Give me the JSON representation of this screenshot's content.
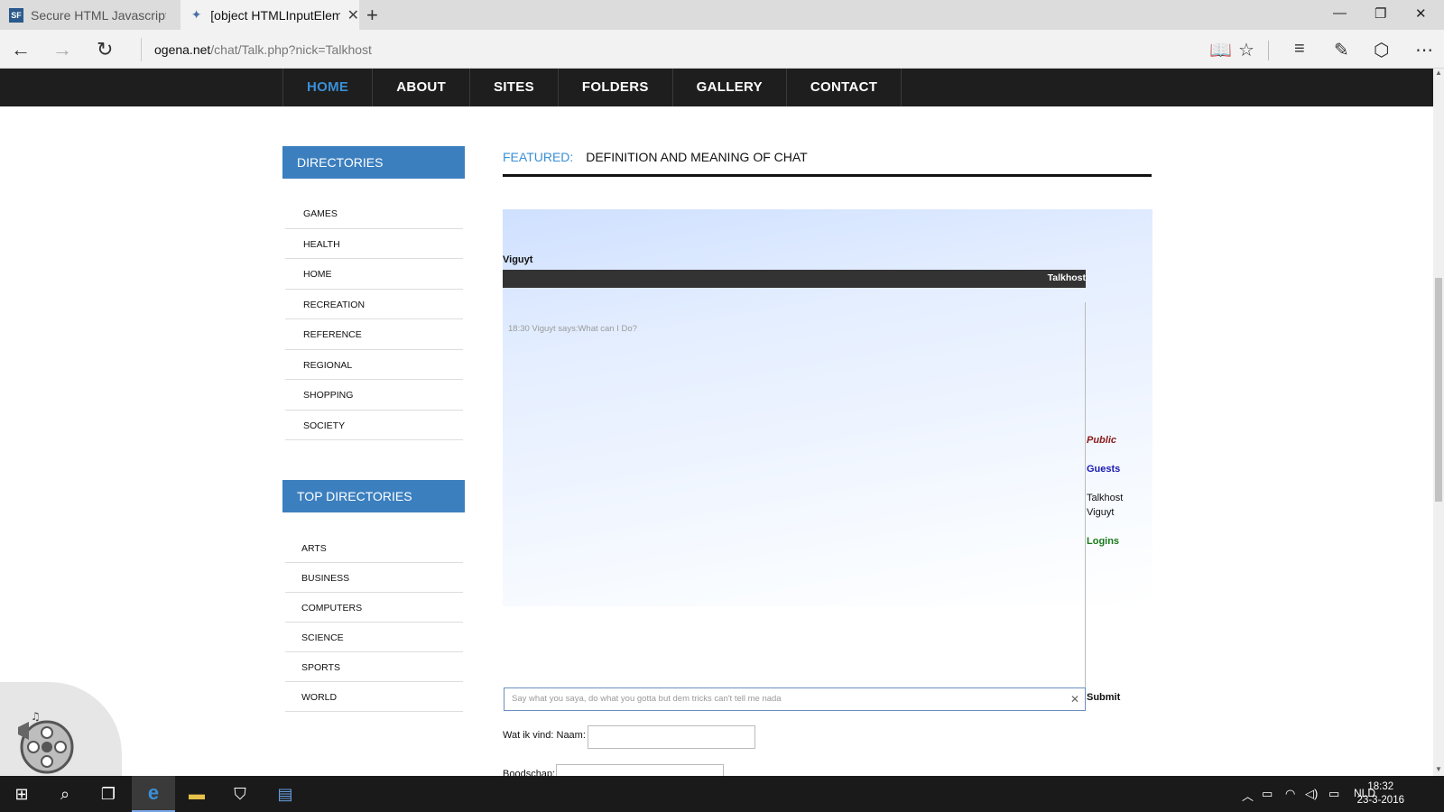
{
  "browser": {
    "tabs": [
      {
        "label": "Secure HTML Javascript Cha",
        "favicon": "SF",
        "active": false
      },
      {
        "label": "[object HTMLInputElem",
        "active": true
      }
    ],
    "url_host": "ogena.net",
    "url_path": "/chat/Talk.php?nick=Talkhost"
  },
  "site": {
    "nav": [
      "HOME",
      "ABOUT",
      "SITES",
      "FOLDERS",
      "GALLERY",
      "CONTACT"
    ],
    "directories_title": "DIRECTORIES",
    "directories": [
      "GAMES",
      "HEALTH",
      "HOME",
      "RECREATION",
      "REFERENCE",
      "REGIONAL",
      "SHOPPING",
      "SOCIETY"
    ],
    "top_directories_title": "TOP DIRECTORIES",
    "top_directories": [
      "ARTS",
      "BUSINESS",
      "COMPUTERS",
      "SCIENCE",
      "SPORTS",
      "WORLD"
    ],
    "featured_label": "FEATURED:",
    "featured_title": "DEFINITION AND MEANING OF CHAT"
  },
  "chat": {
    "current_user": "Viguyt",
    "header_user": "Talkhost",
    "message": "18:30 Viguyt says:What can I Do?",
    "public_label": "Public",
    "guests_label": "Guests",
    "users": [
      "Talkhost",
      "Viguyt"
    ],
    "logins_label": "Logins",
    "input_value": "Say what you saya, do what you gotta but dem tricks can't tell me nada",
    "submit_label": "Submit",
    "name_label": "Wat ik vind: Naam:",
    "message_label": "Boodschap:"
  },
  "taskbar": {
    "language": "NLD",
    "time": "18:32",
    "date": "23-3-2016"
  },
  "colors": {
    "accent": "#3b7fbf",
    "nav_bg": "#1e1e1e",
    "public": "#8b1a1a",
    "guests": "#1a1ab0",
    "logins": "#1a7a1a"
  }
}
